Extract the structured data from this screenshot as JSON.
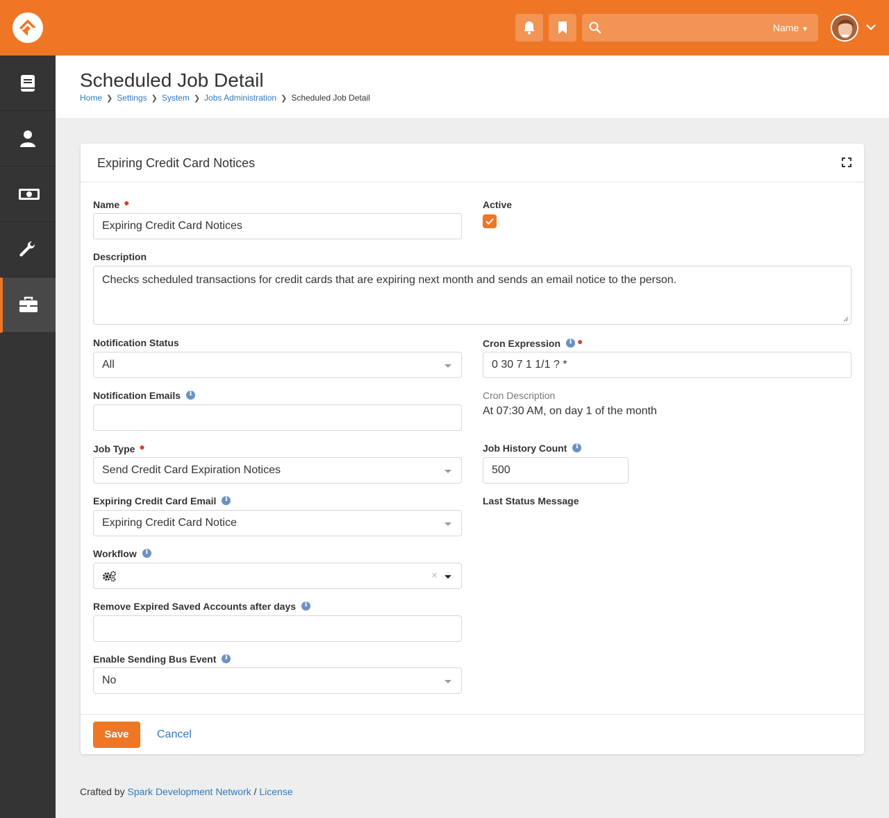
{
  "topbar": {
    "search_filter_label": "Name",
    "colors": {
      "brand": "#ee7625"
    }
  },
  "sidebar": {
    "items": [
      {
        "icon": "book-icon"
      },
      {
        "icon": "person-icon"
      },
      {
        "icon": "money-icon"
      },
      {
        "icon": "wrench-icon"
      },
      {
        "icon": "briefcase-icon",
        "active": true
      }
    ]
  },
  "page": {
    "title": "Scheduled Job Detail",
    "breadcrumb": [
      "Home",
      "Settings",
      "System",
      "Jobs Administration",
      "Scheduled Job Detail"
    ]
  },
  "panel": {
    "title": "Expiring Credit Card Notices",
    "fields": {
      "name": {
        "label": "Name",
        "value": "Expiring Credit Card Notices",
        "required": true
      },
      "active": {
        "label": "Active",
        "checked": true
      },
      "description": {
        "label": "Description",
        "value": "Checks scheduled transactions for credit cards that are expiring next month and sends an email notice to the person."
      },
      "notification_status": {
        "label": "Notification Status",
        "value": "All"
      },
      "cron_expression": {
        "label": "Cron Expression",
        "value": "0 30 7 1 1/1 ? *",
        "required": true
      },
      "notification_emails": {
        "label": "Notification Emails",
        "value": ""
      },
      "cron_description": {
        "label": "Cron Description",
        "value": "At 07:30 AM, on day 1 of the month"
      },
      "job_type": {
        "label": "Job Type",
        "value": "Send Credit Card Expiration Notices",
        "required": true
      },
      "job_history_count": {
        "label": "Job History Count",
        "value": "500"
      },
      "expiring_email": {
        "label": "Expiring Credit Card Email",
        "value": "Expiring Credit Card Notice"
      },
      "last_status_message": {
        "label": "Last Status Message"
      },
      "workflow": {
        "label": "Workflow",
        "clear_glyph": "×"
      },
      "remove_expired": {
        "label": "Remove Expired Saved Accounts after days",
        "value": ""
      },
      "enable_bus_event": {
        "label": "Enable Sending Bus Event",
        "value": "No"
      }
    },
    "actions": {
      "save": "Save",
      "cancel": "Cancel"
    }
  },
  "footer": {
    "prefix": "Crafted by ",
    "org_link": "Spark Development Network",
    "separator": " / ",
    "license_link": "License"
  }
}
